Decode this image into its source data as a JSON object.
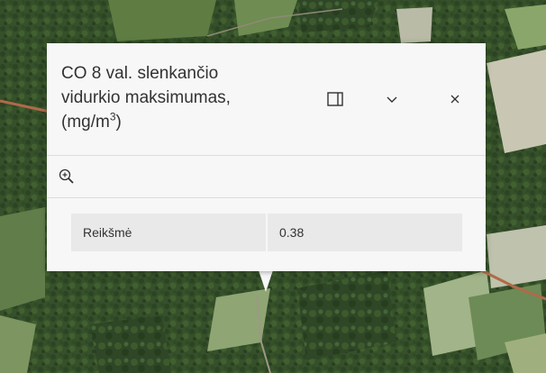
{
  "popup": {
    "title_line1": "CO 8 val. slenkančio",
    "title_line2": "vidurkio maksimumas,",
    "title_line3_pre": "(mg/m",
    "title_sup": "3",
    "title_line3_post": ")",
    "dock_icon": "dock-icon",
    "collapse_icon": "chevron-down-icon",
    "close_icon": "close-icon",
    "zoom_icon": "zoom-to-icon"
  },
  "attributes": [
    {
      "name": "Reikšmė",
      "value": "0.38"
    }
  ],
  "colors": {
    "popup_background": "#f7f7f7",
    "table_row_background": "#e9e9e9",
    "text": "#323232",
    "road": "#b06a4a"
  }
}
